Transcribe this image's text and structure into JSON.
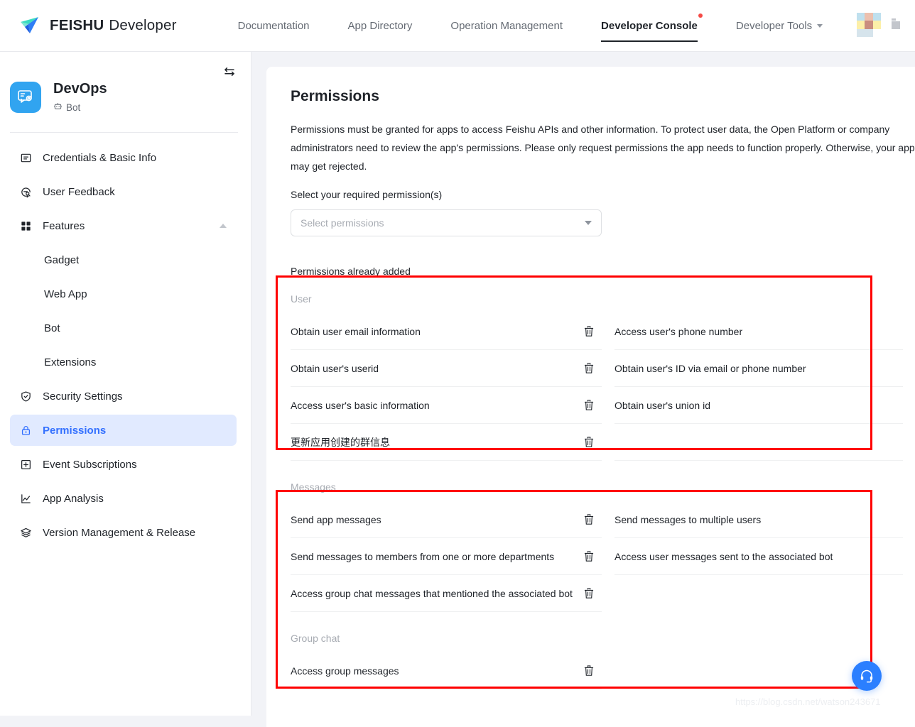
{
  "header": {
    "brand_primary": "FEISHU",
    "brand_secondary": "Developer",
    "logo_icon": "paper-plane-icon",
    "nav": [
      {
        "label": "Documentation",
        "active": false,
        "dot": false,
        "caret": false
      },
      {
        "label": "App Directory",
        "active": false,
        "dot": false,
        "caret": false
      },
      {
        "label": "Operation Management",
        "active": false,
        "dot": false,
        "caret": false
      },
      {
        "label": "Developer Console",
        "active": true,
        "dot": true,
        "caret": false
      },
      {
        "label": "Developer Tools",
        "active": false,
        "dot": false,
        "caret": true
      }
    ],
    "avatar_icon": "user-avatar",
    "doc_icon": "document-icon",
    "accent_color": "#3370ff",
    "notification_dot_color": "#f54a45"
  },
  "sidebar": {
    "collapse_icon": "switch-arrows-icon",
    "app": {
      "name": "DevOps",
      "type": "Bot",
      "type_icon": "bot-icon",
      "icon_bg": "#31a4f0",
      "icon_name": "devops-app-icon"
    },
    "items": [
      {
        "label": "Credentials & Basic Info",
        "icon": "credentials-icon",
        "active": false,
        "sub": false,
        "caret": false
      },
      {
        "label": "User Feedback",
        "icon": "feedback-icon",
        "active": false,
        "sub": false,
        "caret": false
      },
      {
        "label": "Features",
        "icon": "grid-icon",
        "active": false,
        "sub": false,
        "caret": true
      },
      {
        "label": "Gadget",
        "icon": "",
        "active": false,
        "sub": true,
        "caret": false
      },
      {
        "label": "Web App",
        "icon": "",
        "active": false,
        "sub": true,
        "caret": false
      },
      {
        "label": "Bot",
        "icon": "",
        "active": false,
        "sub": true,
        "caret": false
      },
      {
        "label": "Extensions",
        "icon": "",
        "active": false,
        "sub": true,
        "caret": false
      },
      {
        "label": "Security Settings",
        "icon": "shield-icon",
        "active": false,
        "sub": false,
        "caret": false
      },
      {
        "label": "Permissions",
        "icon": "lock-icon",
        "active": true,
        "sub": false,
        "caret": false
      },
      {
        "label": "Event Subscriptions",
        "icon": "plus-box-icon",
        "active": false,
        "sub": false,
        "caret": false
      },
      {
        "label": "App Analysis",
        "icon": "chart-icon",
        "active": false,
        "sub": false,
        "caret": false
      },
      {
        "label": "Version Management & Release",
        "icon": "layers-icon",
        "active": false,
        "sub": false,
        "caret": false
      }
    ]
  },
  "main": {
    "title": "Permissions",
    "description": "Permissions must be granted for apps to access Feishu APIs and other information. To protect user data, the Open Platform or company administrators need to review the app's permissions. Please only request permissions the app needs to function properly. Otherwise, your app may get rejected.",
    "select_label": "Select your required permission(s)",
    "select_placeholder": "Select permissions",
    "select_caret_icon": "chevron-down-icon",
    "added_label": "Permissions already added",
    "groups": [
      {
        "title": "User",
        "rows": [
          {
            "left": "Obtain user email information",
            "right": "Access user's phone number"
          },
          {
            "left": "Obtain user's userid",
            "right": "Obtain user's ID via email or phone number"
          },
          {
            "left": "Access user's basic information",
            "right": "Obtain user's union id"
          },
          {
            "left": "更新应用创建的群信息",
            "right": ""
          }
        ]
      },
      {
        "title": "Messages",
        "rows": [
          {
            "left": "Send app messages",
            "right": "Send messages to multiple users"
          },
          {
            "left": "Send messages to members from one or more departments",
            "right": "Access user messages sent to the associated bot"
          },
          {
            "left": "Access group chat messages that mentioned the associated bot",
            "right": ""
          }
        ]
      },
      {
        "title": "Group chat",
        "rows": [
          {
            "left": "Access group messages",
            "right": ""
          }
        ]
      }
    ],
    "delete_icon": "trash-icon"
  },
  "support_button": {
    "icon": "headset-icon",
    "color": "#2b7fff"
  },
  "watermark": "https://blog.csdn.net/watson243671",
  "annotations": {
    "box_color": "#ff0000"
  }
}
